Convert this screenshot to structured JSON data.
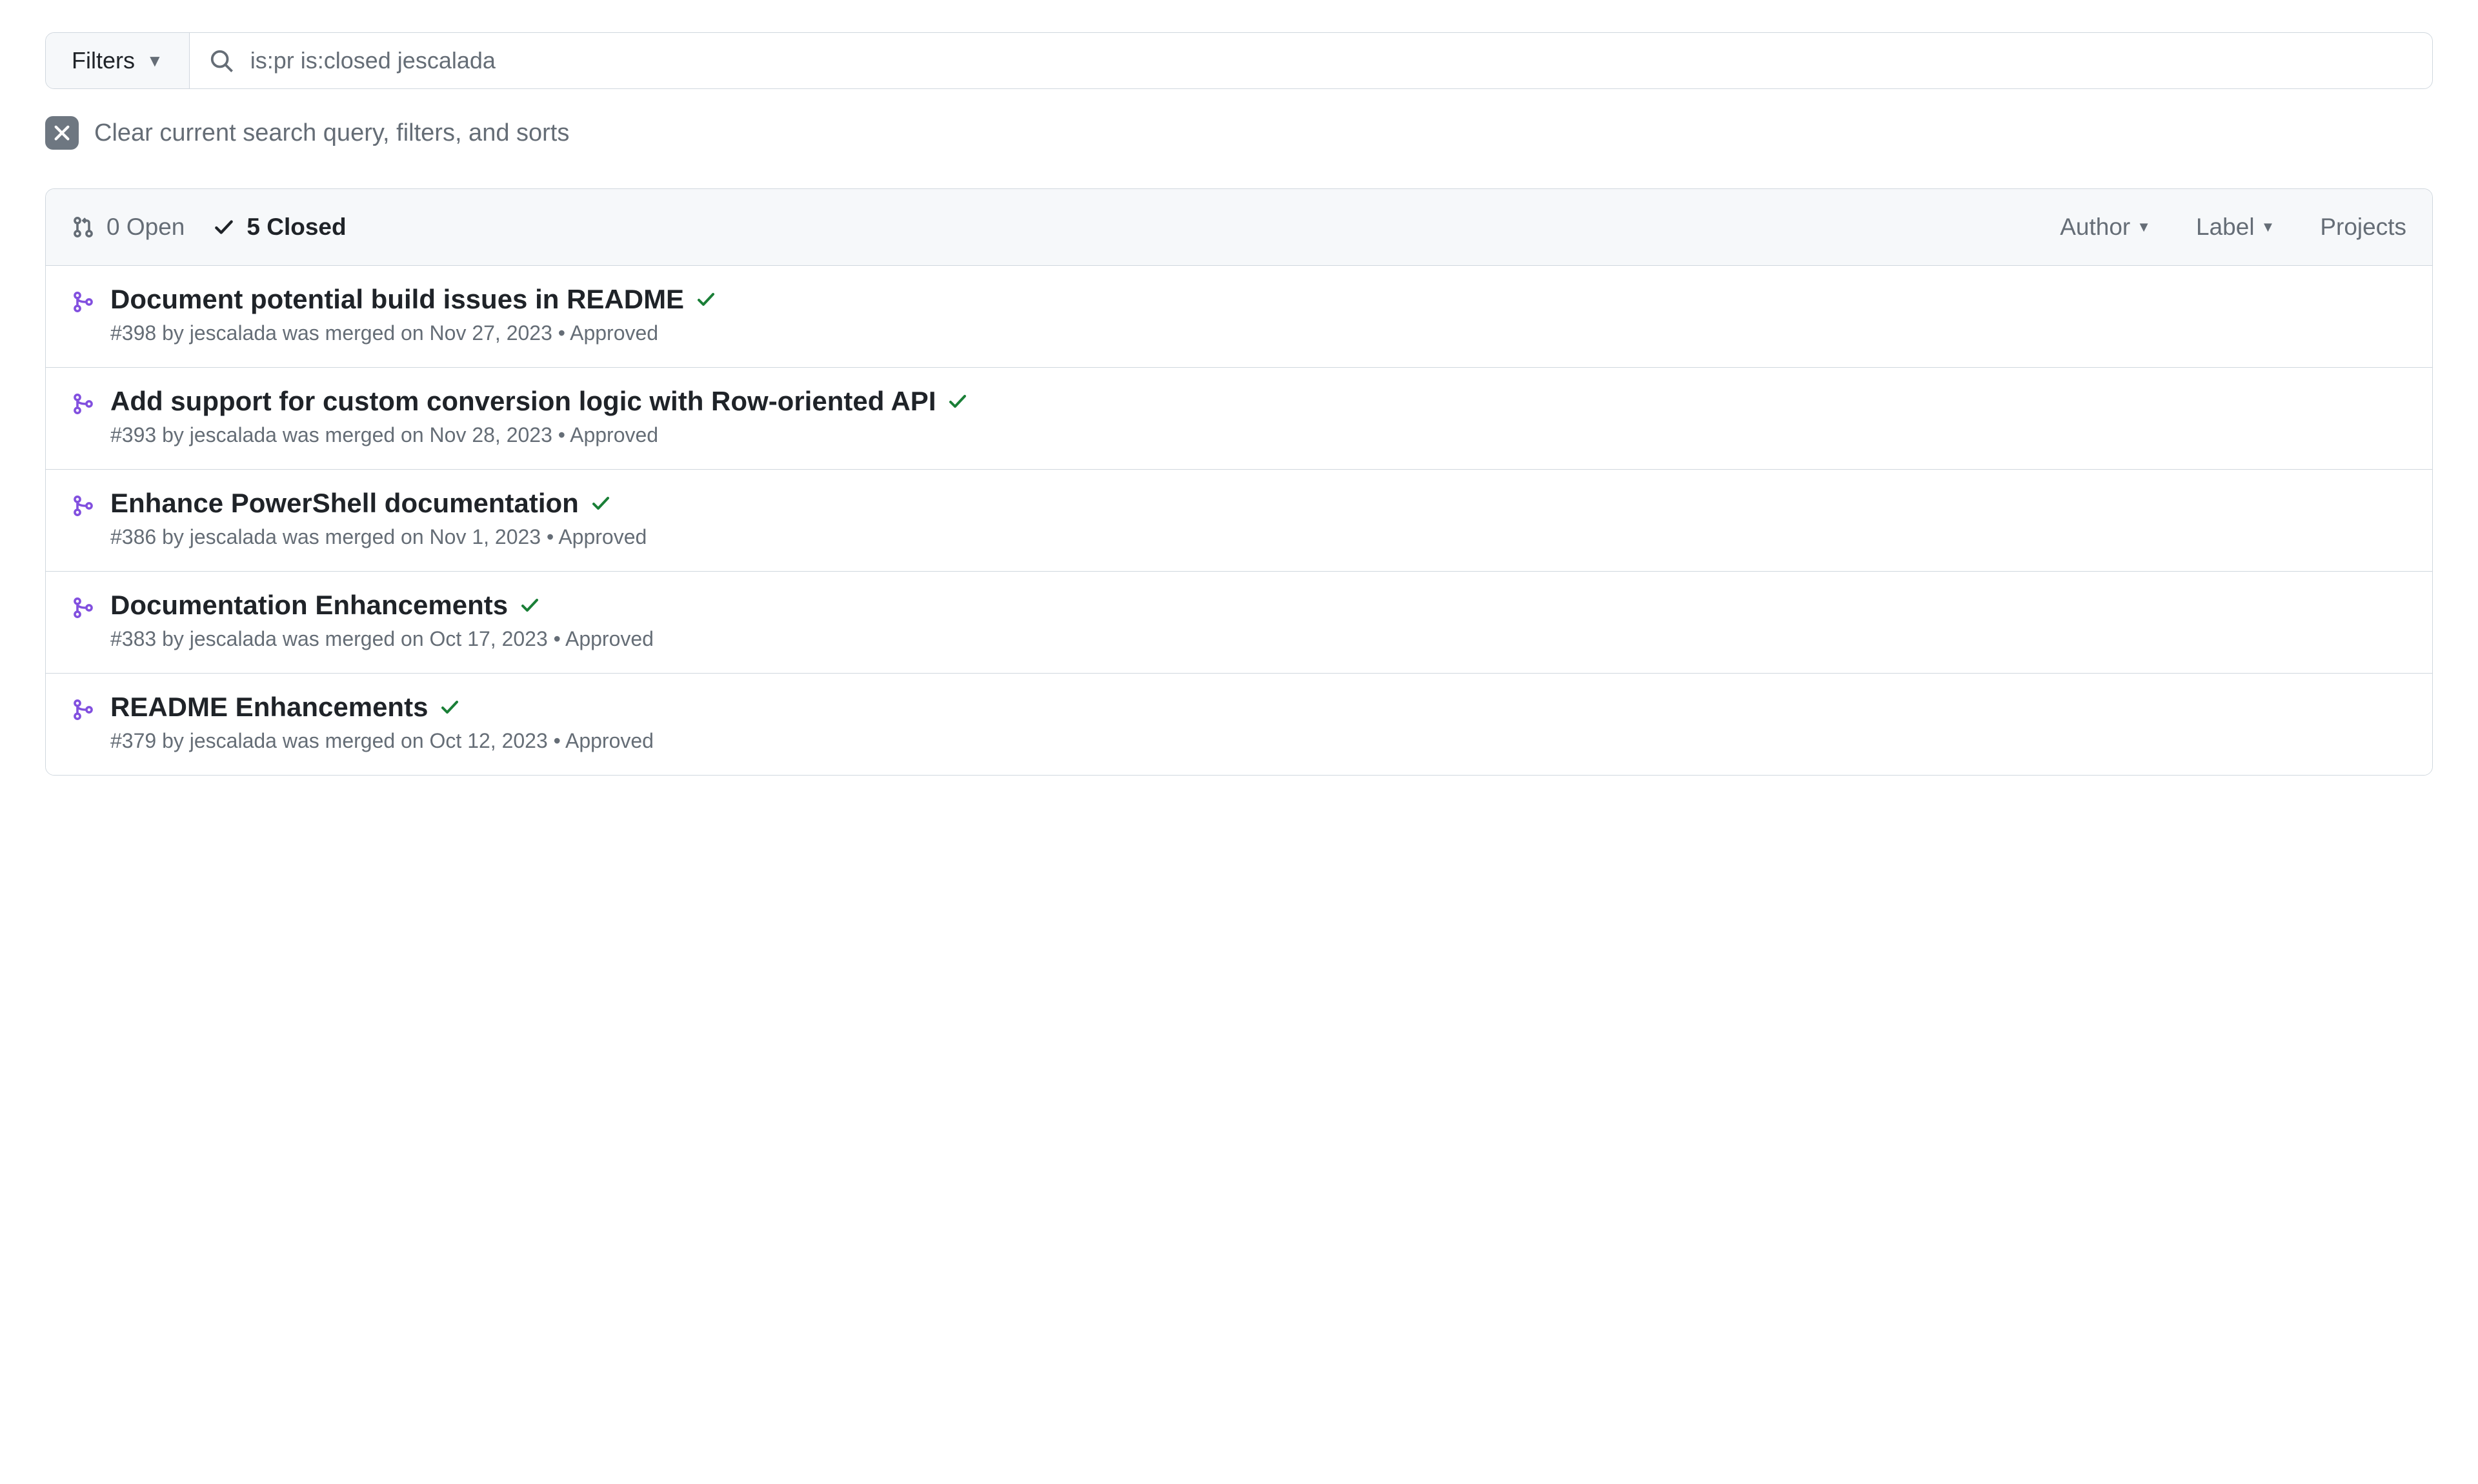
{
  "search": {
    "filters_label": "Filters",
    "query": "is:pr is:closed jescalada"
  },
  "clear": {
    "text": "Clear current search query, filters, and sorts"
  },
  "header": {
    "open_count": "0 Open",
    "closed_count": "5 Closed",
    "filter_author": "Author",
    "filter_label": "Label",
    "filter_projects": "Projects"
  },
  "prs": [
    {
      "title": "Document potential build issues in README",
      "sub": "#398 by jescalada was merged on Nov 27, 2023 • Approved"
    },
    {
      "title": "Add support for custom conversion logic with Row-oriented API",
      "sub": "#393 by jescalada was merged on Nov 28, 2023 • Approved"
    },
    {
      "title": "Enhance PowerShell documentation",
      "sub": "#386 by jescalada was merged on Nov 1, 2023 • Approved"
    },
    {
      "title": "Documentation Enhancements",
      "sub": "#383 by jescalada was merged on Oct 17, 2023 • Approved"
    },
    {
      "title": "README Enhancements",
      "sub": "#379 by jescalada was merged on Oct 12, 2023 • Approved"
    }
  ]
}
